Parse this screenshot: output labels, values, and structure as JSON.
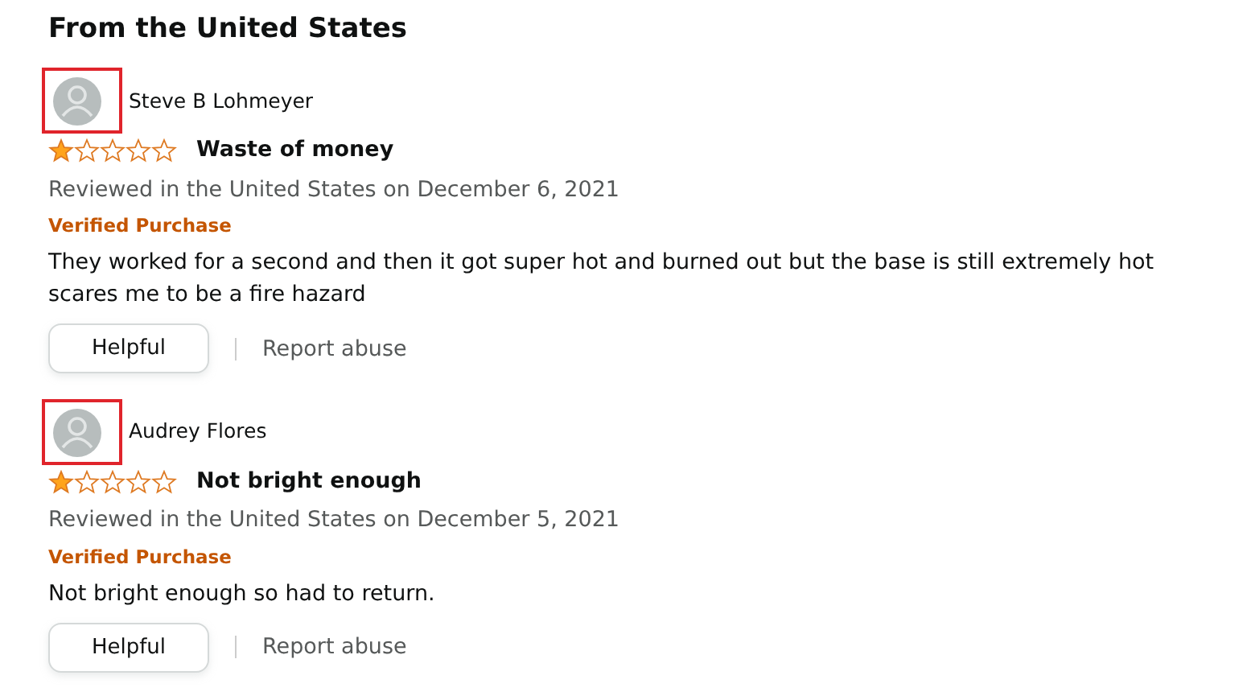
{
  "heading": "From the United States",
  "reviews": [
    {
      "author": "Steve B Lohmeyer",
      "highlighted": true,
      "stars": 1,
      "title": "Waste of money",
      "date": "Reviewed in the United States on December 6, 2021",
      "badge": "Verified Purchase",
      "body": "They worked for a second and then it got super hot and burned out but the base is still extremely hot scares me to be a fire hazard",
      "helpful": "Helpful",
      "report": "Report abuse"
    },
    {
      "author": "Audrey Flores",
      "highlighted": true,
      "stars": 1,
      "title": "Not bright enough",
      "date": "Reviewed in the United States on December 5, 2021",
      "badge": "Verified Purchase",
      "body": "Not bright enough so had to return.",
      "helpful": "Helpful",
      "report": "Report abuse"
    }
  ]
}
